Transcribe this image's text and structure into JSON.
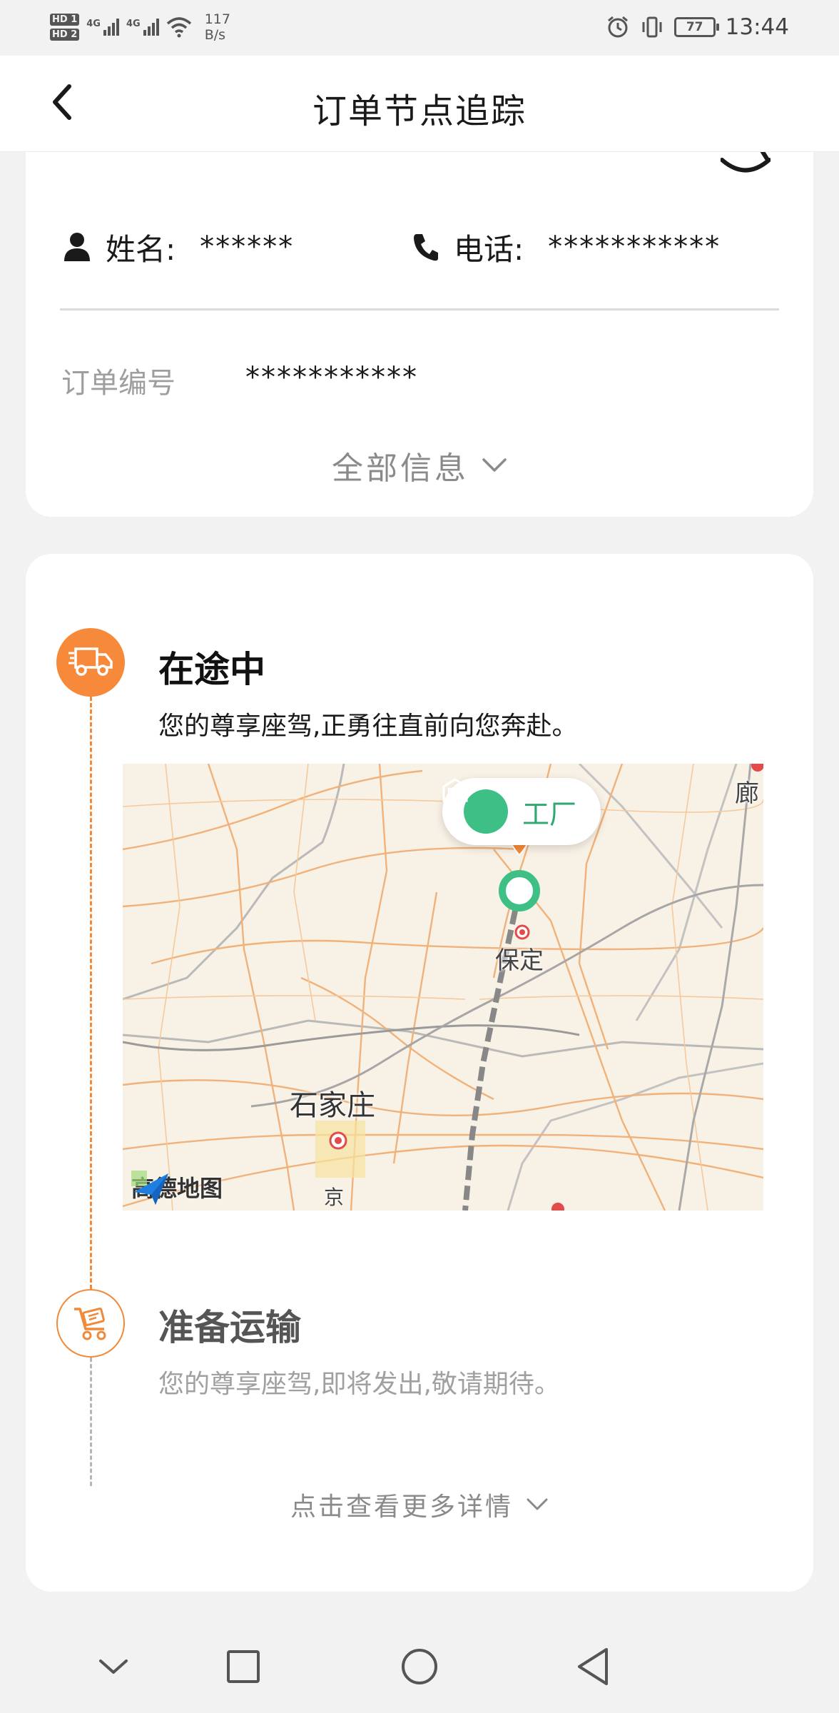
{
  "status_bar": {
    "hd1": "HD 1",
    "hd2": "HD 2",
    "network1": "4G",
    "network2": "4G",
    "net_speed_value": "117",
    "net_speed_unit": "B/s",
    "battery": "77",
    "time": "13:44",
    "icons": [
      "alarm-icon",
      "vibrate-icon",
      "battery-icon",
      "wifi-icon",
      "signal-icon"
    ]
  },
  "header": {
    "title": "订单节点追踪",
    "back_icon": "chevron-left-icon"
  },
  "contact": {
    "name_label": "姓名:",
    "name_value": "******",
    "phone_label": "电话:",
    "phone_value": "***********"
  },
  "order": {
    "number_label": "订单编号",
    "number_value": "***********",
    "all_info_label": "全部信息"
  },
  "tracking": {
    "steps": [
      {
        "title": "在途中",
        "description": "您的尊享座驾,正勇往直前向您奔赴。",
        "icon": "truck-icon",
        "state": "active"
      },
      {
        "title": "准备运输",
        "description": "您的尊享座驾,即将发出,敬请期待。",
        "icon": "cart-icon",
        "state": "pending"
      }
    ],
    "map": {
      "factory_label": "工厂",
      "cities": [
        "保定",
        "石家庄",
        "廊",
        "京"
      ],
      "provider": "高德地图"
    },
    "more_details_label": "点击查看更多详情"
  },
  "colors": {
    "accent": "#f68a3a",
    "factory_green": "#3dbf85",
    "muted_text": "#8a8a8a"
  }
}
